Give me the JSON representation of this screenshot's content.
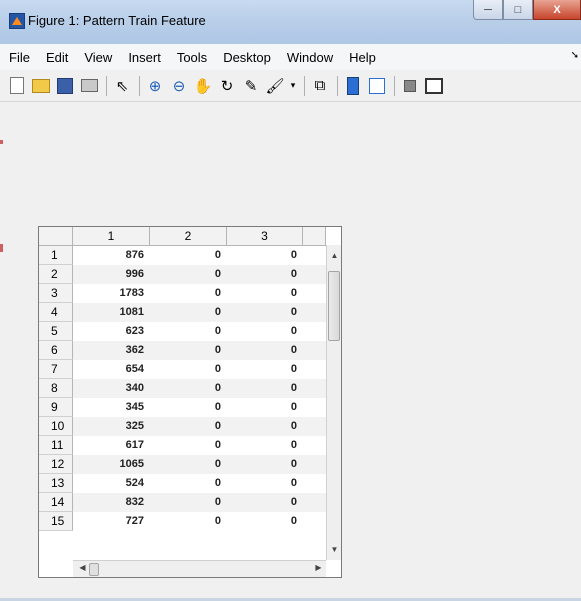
{
  "window": {
    "title": "Figure 1: Pattern Train Feature",
    "minimize": "─",
    "maximize": "□",
    "close": "X"
  },
  "menubar": {
    "items": [
      "File",
      "Edit",
      "View",
      "Insert",
      "Tools",
      "Desktop",
      "Window",
      "Help"
    ]
  },
  "toolbar": {
    "icons": [
      "new-figure-icon",
      "open-file-icon",
      "save-icon",
      "print-icon",
      "select-arrow-icon",
      "zoom-in-icon",
      "zoom-out-icon",
      "pan-hand-icon",
      "rotate-3d-icon",
      "data-cursor-icon",
      "brush-icon",
      "link-plot-icon",
      "colorbar-icon",
      "legend-icon",
      "hide-plot-tools-icon",
      "show-plot-tools-icon"
    ]
  },
  "table": {
    "columns": [
      "1",
      "2",
      "3"
    ],
    "rows": [
      {
        "id": "1",
        "values": [
          "876",
          "0",
          "0"
        ]
      },
      {
        "id": "2",
        "values": [
          "996",
          "0",
          "0"
        ]
      },
      {
        "id": "3",
        "values": [
          "1783",
          "0",
          "0"
        ]
      },
      {
        "id": "4",
        "values": [
          "1081",
          "0",
          "0"
        ]
      },
      {
        "id": "5",
        "values": [
          "623",
          "0",
          "0"
        ]
      },
      {
        "id": "6",
        "values": [
          "362",
          "0",
          "0"
        ]
      },
      {
        "id": "7",
        "values": [
          "654",
          "0",
          "0"
        ]
      },
      {
        "id": "8",
        "values": [
          "340",
          "0",
          "0"
        ]
      },
      {
        "id": "9",
        "values": [
          "345",
          "0",
          "0"
        ]
      },
      {
        "id": "10",
        "values": [
          "325",
          "0",
          "0"
        ]
      },
      {
        "id": "11",
        "values": [
          "617",
          "0",
          "0"
        ]
      },
      {
        "id": "12",
        "values": [
          "1065",
          "0",
          "0"
        ]
      },
      {
        "id": "13",
        "values": [
          "524",
          "0",
          "0"
        ]
      },
      {
        "id": "14",
        "values": [
          "832",
          "0",
          "0"
        ]
      },
      {
        "id": "15",
        "values": [
          "727",
          "0",
          "0"
        ]
      }
    ]
  }
}
